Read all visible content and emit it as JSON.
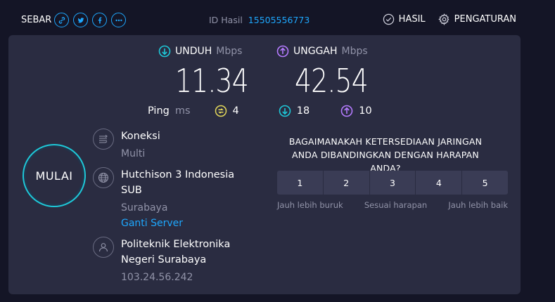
{
  "header": {
    "share_label": "SEBAR",
    "result_id_label": "ID Hasil",
    "result_id": "15505556773",
    "results_label": "HASIL",
    "settings_label": "PENGATURAN"
  },
  "metrics": {
    "download": {
      "label": "UNDUH",
      "unit": "Mbps",
      "value": "11.34"
    },
    "upload": {
      "label": "UNGGAH",
      "unit": "Mbps",
      "value": "42.54"
    }
  },
  "ping": {
    "label": "Ping",
    "unit": "ms",
    "idle": "4",
    "download": "18",
    "upload": "10"
  },
  "go_button": {
    "label": "MULAI"
  },
  "connection": {
    "title": "Koneksi",
    "value": "Multi"
  },
  "server": {
    "name": "Hutchison 3 Indonesia SUB",
    "location": "Surabaya",
    "change_link": "Ganti Server"
  },
  "client": {
    "name": "Politeknik Elektronika Negeri Surabaya",
    "ip": "103.24.56.242"
  },
  "survey": {
    "question": "BAGAIMANAKAH KETERSEDIAAN JARINGAN ANDA DIBANDINGKAN DENGAN HARAPAN ANDA?",
    "options": [
      "1",
      "2",
      "3",
      "4",
      "5"
    ],
    "low_label": "Jauh lebih buruk",
    "mid_label": "Sesuai harapan",
    "high_label": "Jauh lebih baik"
  },
  "colors": {
    "download_accent": "#1ec8d8",
    "upload_accent": "#b57bff",
    "ping_accent": "#e4d85a",
    "link": "#1ea7fd"
  }
}
